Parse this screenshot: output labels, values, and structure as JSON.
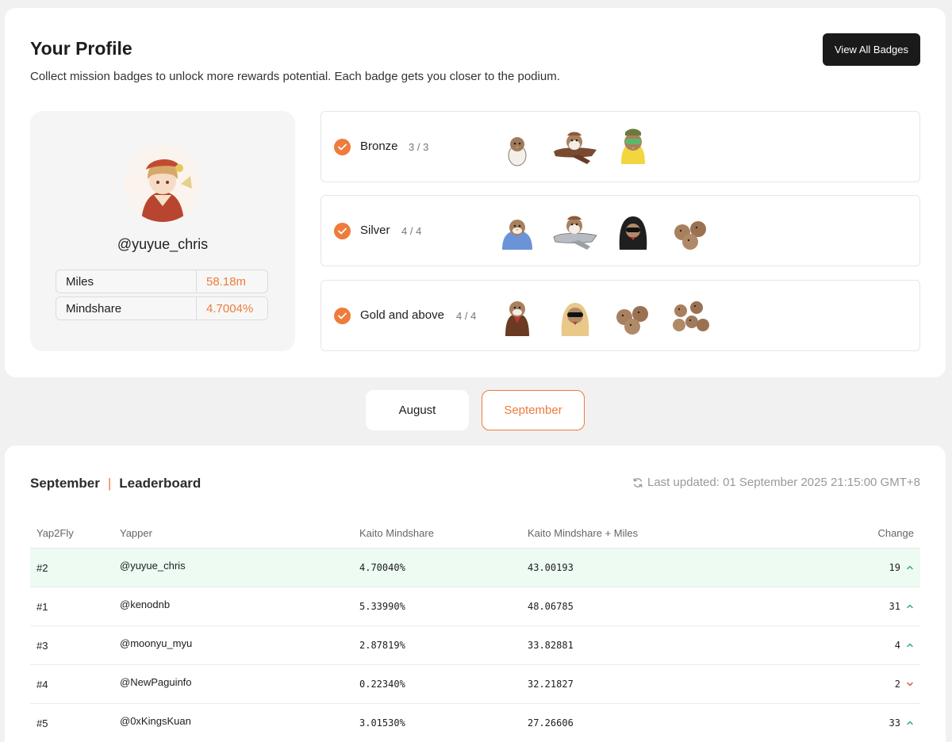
{
  "profile": {
    "title": "Your Profile",
    "subtitle": "Collect mission badges to unlock more rewards potential. Each badge gets you closer to the podium.",
    "view_all_badges_label": "View All Badges",
    "username": "@yuyue_chris",
    "stats": [
      {
        "label": "Miles",
        "value": "58.18m"
      },
      {
        "label": "Mindshare",
        "value": "4.7004%"
      }
    ],
    "tiers": [
      {
        "name": "Bronze",
        "count": "3 / 3",
        "badges": [
          "egg-bird-badge",
          "airplane-bird-badge",
          "goggles-bird-badge"
        ]
      },
      {
        "name": "Silver",
        "count": "4 / 4",
        "badges": [
          "blanket-bird-badge",
          "silver-plane-bird-badge",
          "hooded-bird-badge",
          "bird-trio-badge"
        ]
      },
      {
        "name": "Gold and above",
        "count": "4 / 4",
        "badges": [
          "jacket-bird-badge",
          "sunglasses-bird-badge",
          "bird-trio-badge",
          "bird-squad-badge"
        ]
      }
    ]
  },
  "month_tabs": [
    {
      "label": "August",
      "selected": false
    },
    {
      "label": "September",
      "selected": true
    }
  ],
  "leaderboard": {
    "month": "September",
    "title": "Leaderboard",
    "last_updated": "Last updated: 01 September 2025 21:15:00 GMT+8",
    "columns": [
      "Yap2Fly",
      "Yapper",
      "Kaito Mindshare",
      "Kaito Mindshare + Miles",
      "Change"
    ],
    "rows": [
      {
        "rank": "#2",
        "yapper": "@yuyue_chris",
        "mindshare": "4.70040%",
        "mindshare_miles": "43.00193",
        "change": "19",
        "direction": "up"
      },
      {
        "rank": "#1",
        "yapper": "@kenodnb",
        "mindshare": "5.33990%",
        "mindshare_miles": "48.06785",
        "change": "31",
        "direction": "up"
      },
      {
        "rank": "#3",
        "yapper": "@moonyu_myu",
        "mindshare": "2.87819%",
        "mindshare_miles": "33.82881",
        "change": "4",
        "direction": "up"
      },
      {
        "rank": "#4",
        "yapper": "@NewPaguinfo",
        "mindshare": "0.22340%",
        "mindshare_miles": "32.21827",
        "change": "2",
        "direction": "down"
      },
      {
        "rank": "#5",
        "yapper": "@0xKingsKuan",
        "mindshare": "3.01530%",
        "mindshare_miles": "27.26606",
        "change": "33",
        "direction": "up"
      }
    ]
  },
  "colors": {
    "accent": "#ef7b3c",
    "up": "#2fa36b",
    "down": "#e0483b",
    "highlight_row": "#edfbf2"
  }
}
